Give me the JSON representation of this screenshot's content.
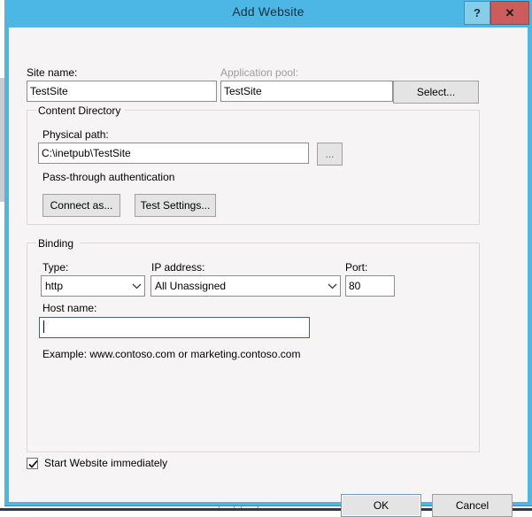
{
  "window": {
    "title": "Add Website",
    "help_button": "?",
    "close_button": "✕"
  },
  "site": {
    "site_name_label": "Site name:",
    "site_name_value": "TestSite",
    "app_pool_label": "Application pool:",
    "app_pool_value": "TestSite",
    "select_button": "Select..."
  },
  "content_directory": {
    "group_title": "Content Directory",
    "physical_path_label": "Physical path:",
    "physical_path_value": "C:\\inetpub\\TestSite",
    "browse_button": "...",
    "auth_text": "Pass-through authentication",
    "connect_as_button": "Connect as...",
    "test_settings_button": "Test Settings..."
  },
  "binding": {
    "group_title": "Binding",
    "type_label": "Type:",
    "type_value": "http",
    "ip_label": "IP address:",
    "ip_value": "All Unassigned",
    "port_label": "Port:",
    "port_value": "80",
    "host_name_label": "Host name:",
    "host_name_value": "",
    "example_text": "Example: www.contoso.com or marketing.contoso.com"
  },
  "footer": {
    "start_website_label": "Start Website immediately",
    "start_website_checked": true,
    "ok_button": "OK",
    "cancel_button": "Cancel"
  },
  "colors": {
    "title_bar": "#4cb7e5",
    "close_button": "#cd5c5c",
    "help_button": "#86cdea",
    "dialog_body": "#f7f4f6",
    "button_face": "#e4e4e4",
    "focus_border": "#6b9cc4"
  }
}
